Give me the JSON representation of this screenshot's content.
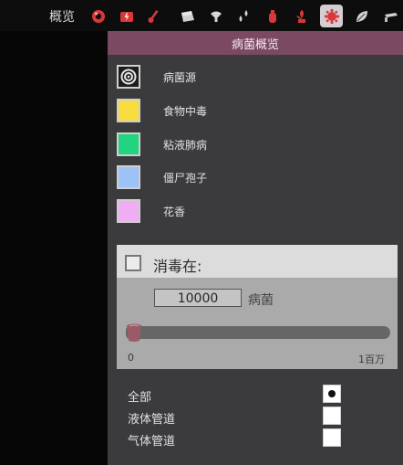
{
  "topbar": {
    "title": "概览",
    "overlay_buttons": [
      {
        "name": "oxygen-overlay",
        "icon": "oxygen-icon"
      },
      {
        "name": "power-overlay",
        "icon": "power-icon"
      },
      {
        "name": "temperature-overlay",
        "icon": "thermometer-icon"
      },
      {
        "name": "materials-overlay",
        "icon": "materials-icon"
      },
      {
        "name": "light-overlay",
        "icon": "light-bulb-icon"
      },
      {
        "name": "plumbing-overlay",
        "icon": "drop-icon"
      },
      {
        "name": "ventilation-overlay",
        "icon": "gas-canister-icon"
      },
      {
        "name": "farming-overlay",
        "icon": "plant-icon"
      },
      {
        "name": "germ-overlay",
        "icon": "germ-icon",
        "active": true
      },
      {
        "name": "leaf-overlay",
        "icon": "leaf-icon"
      },
      {
        "name": "conveyor-overlay",
        "icon": "conveyor-icon"
      }
    ]
  },
  "panel": {
    "title": "病菌概览",
    "legend": [
      {
        "label": "病菌源",
        "color": "#ffffff",
        "icon": "germ-source-icon"
      },
      {
        "label": "食物中毒",
        "color": "#f7dc3f"
      },
      {
        "label": "粘液肺病",
        "color": "#22d47f"
      },
      {
        "label": "僵尸孢子",
        "color": "#9cc2f7"
      },
      {
        "label": "花香",
        "color": "#efaef4"
      }
    ],
    "disinfect": {
      "label": "消毒在:",
      "checked": false,
      "threshold_value": "10000",
      "threshold_unit": "病菌",
      "slider_min_label": "0",
      "slider_max_label": "1百万",
      "slider_fraction": 0.01
    },
    "filters": [
      {
        "label": "全部",
        "selected": true
      },
      {
        "label": "液体管道",
        "selected": false
      },
      {
        "label": "气体管道",
        "selected": false
      }
    ]
  },
  "colors": {
    "header": "#7b4a62",
    "panel_bg": "#3b3b3d",
    "accent_red": "#d8383a",
    "active_button_bg": "#d4cdd2"
  }
}
